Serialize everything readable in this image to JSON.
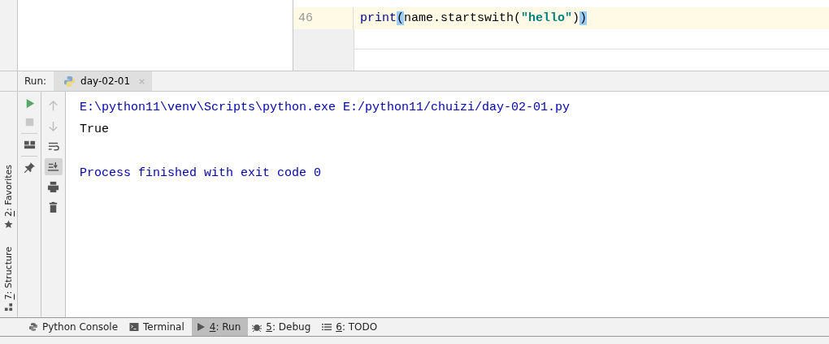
{
  "editor": {
    "lines": [
      {
        "number": "46",
        "current": true,
        "tokens": [
          {
            "kind": "builtin",
            "text": "print"
          },
          {
            "kind": "match",
            "text": "("
          },
          {
            "kind": "plain",
            "text": "name.startswith("
          },
          {
            "kind": "string",
            "text": "\"hello\""
          },
          {
            "kind": "plain",
            "text": ")"
          },
          {
            "kind": "match",
            "text": ")"
          }
        ]
      }
    ]
  },
  "run_panel": {
    "label": "Run:",
    "tabs": [
      {
        "label": "day-02-01",
        "selected": true
      }
    ]
  },
  "left_actions": [
    {
      "kind": "run",
      "disabled": false
    },
    {
      "kind": "stop",
      "disabled": true
    },
    {
      "kind": "layout",
      "disabled": false
    },
    {
      "kind": "pin",
      "disabled": false
    }
  ],
  "right_actions": [
    {
      "kind": "up",
      "disabled": true,
      "selected": false
    },
    {
      "kind": "down",
      "disabled": true,
      "selected": false
    },
    {
      "kind": "wrap",
      "disabled": false,
      "selected": false
    },
    {
      "kind": "scroll-end",
      "disabled": false,
      "selected": true
    },
    {
      "kind": "print",
      "disabled": false,
      "selected": false
    },
    {
      "kind": "trash",
      "disabled": false,
      "selected": false
    }
  ],
  "console": [
    {
      "kind": "system",
      "text": "E:\\python11\\venv\\Scripts\\python.exe E:/python11/chuizi/day-02-01.py"
    },
    {
      "kind": "output",
      "text": "True"
    },
    {
      "kind": "blank"
    },
    {
      "kind": "system",
      "text": "Process finished with exit code 0"
    }
  ],
  "side_tools": [
    {
      "kind": "favorites",
      "label": "2: Favorites",
      "mnemonic": true
    },
    {
      "kind": "structure",
      "label": "7: Structure",
      "mnemonic": true
    }
  ],
  "bottom_tools": [
    {
      "kind": "python",
      "label": "Python Console",
      "mnemonic": false,
      "selected": false
    },
    {
      "kind": "terminal",
      "label": "Terminal",
      "mnemonic": false,
      "selected": false
    },
    {
      "kind": "run",
      "label": "4: Run",
      "mnemonic": true,
      "selected": true
    },
    {
      "kind": "debug",
      "label": "5: Debug",
      "mnemonic": true,
      "selected": false
    },
    {
      "kind": "todo",
      "label": "6: TODO",
      "mnemonic": true,
      "selected": false
    }
  ]
}
